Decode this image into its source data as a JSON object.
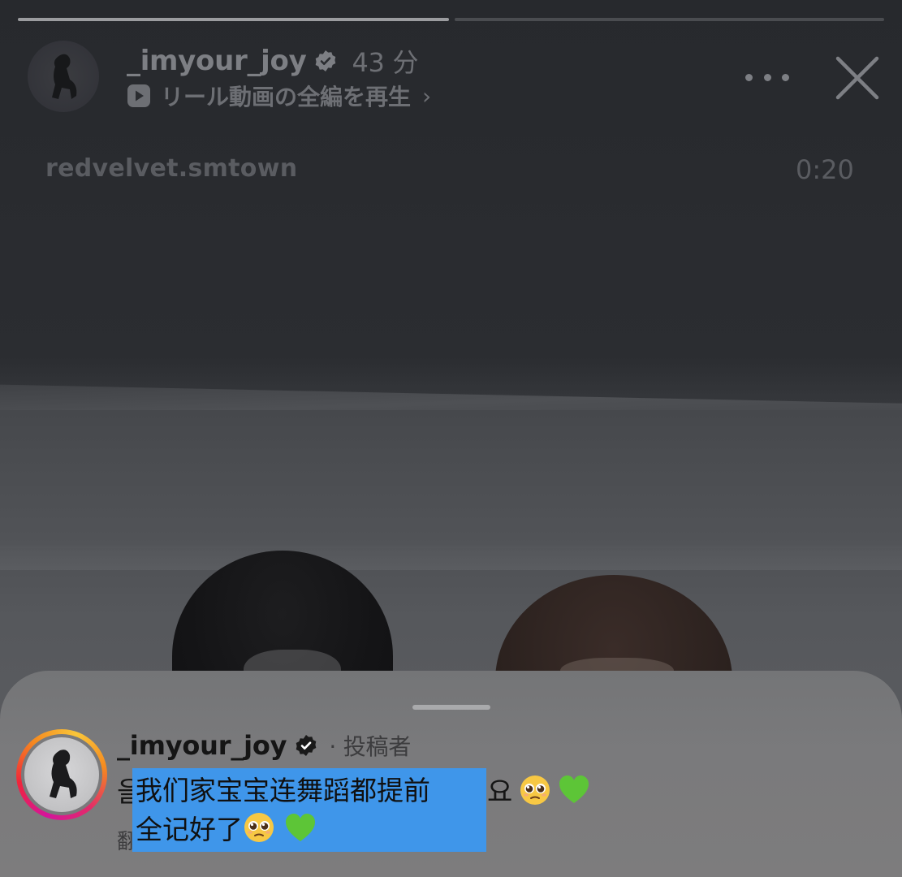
{
  "header": {
    "username": "_imyour_joy",
    "time": "43 分",
    "reel_link": "リール動画の全編を再生",
    "reel_link_chevron": "›"
  },
  "video": {
    "sticker_username": "redvelvet.smtown",
    "time_remaining": "0:20",
    "progress": [
      1.0,
      0.0
    ]
  },
  "comment": {
    "username": "_imyour_joy",
    "author_label": "· 投稿者",
    "text_prefix": "을",
    "text_suffix": "요",
    "translate_hint": "翻"
  },
  "translation_overlay": {
    "text": "我们家宝宝连舞蹈都提前\n全记好了"
  },
  "icons": {
    "verified": "verified-badge-icon",
    "reel": "play-square-icon",
    "more": "more-icon",
    "close": "close-icon",
    "plead_emoji": "pleading-face-emoji",
    "heart_emoji": "green-heart-emoji"
  },
  "colors": {
    "story_ring": [
      "#d4149b",
      "#f0263a",
      "#f58a1f",
      "#f9c63a"
    ],
    "overlay_blue": "#3f96ea",
    "heart_green": "#5dc537"
  }
}
